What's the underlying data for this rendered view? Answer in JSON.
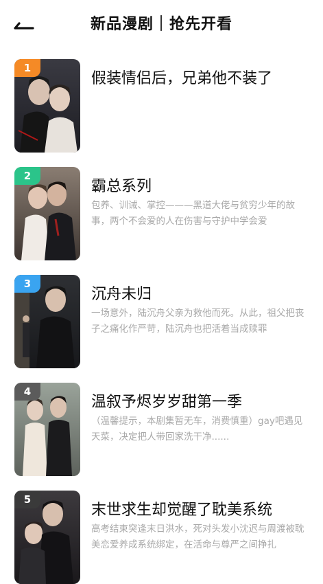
{
  "header": {
    "title": "新品漫剧｜抢先开看"
  },
  "items": [
    {
      "rank": "1",
      "rank_color": "#F58A26",
      "title": "假装情侣后，兄弟他不装了",
      "desc": ""
    },
    {
      "rank": "2",
      "rank_color": "#2BC48A",
      "title": "霸总系列",
      "desc": "包养、训诫、掌控———黑道大佬与贫穷少年的故事，两个不会爱的人在伤害与守护中学会爱"
    },
    {
      "rank": "3",
      "rank_color": "#3AA4F0",
      "title": "沉舟未归",
      "desc": "一场意外，陆沉舟父亲为救他而死。从此，祖父把丧子之痛化作严苛，陆沉舟也把活着当成赎罪"
    },
    {
      "rank": "4",
      "rank_color": "#5B5B5B",
      "title": "温叙予烬岁岁甜第一季",
      "desc": "（温馨提示，本剧集暂无车，消费慎重）gay吧遇见天菜，决定把人带回家洗干净......"
    },
    {
      "rank": "5",
      "rank_color": "#3A3A3A",
      "title": "末世求生却觉醒了耽美系统",
      "desc": "高考结束突逢末日洪水，死对头发小沈迟与周渡被耽美恋爱养成系统绑定，在活命与尊严之间挣扎"
    }
  ]
}
